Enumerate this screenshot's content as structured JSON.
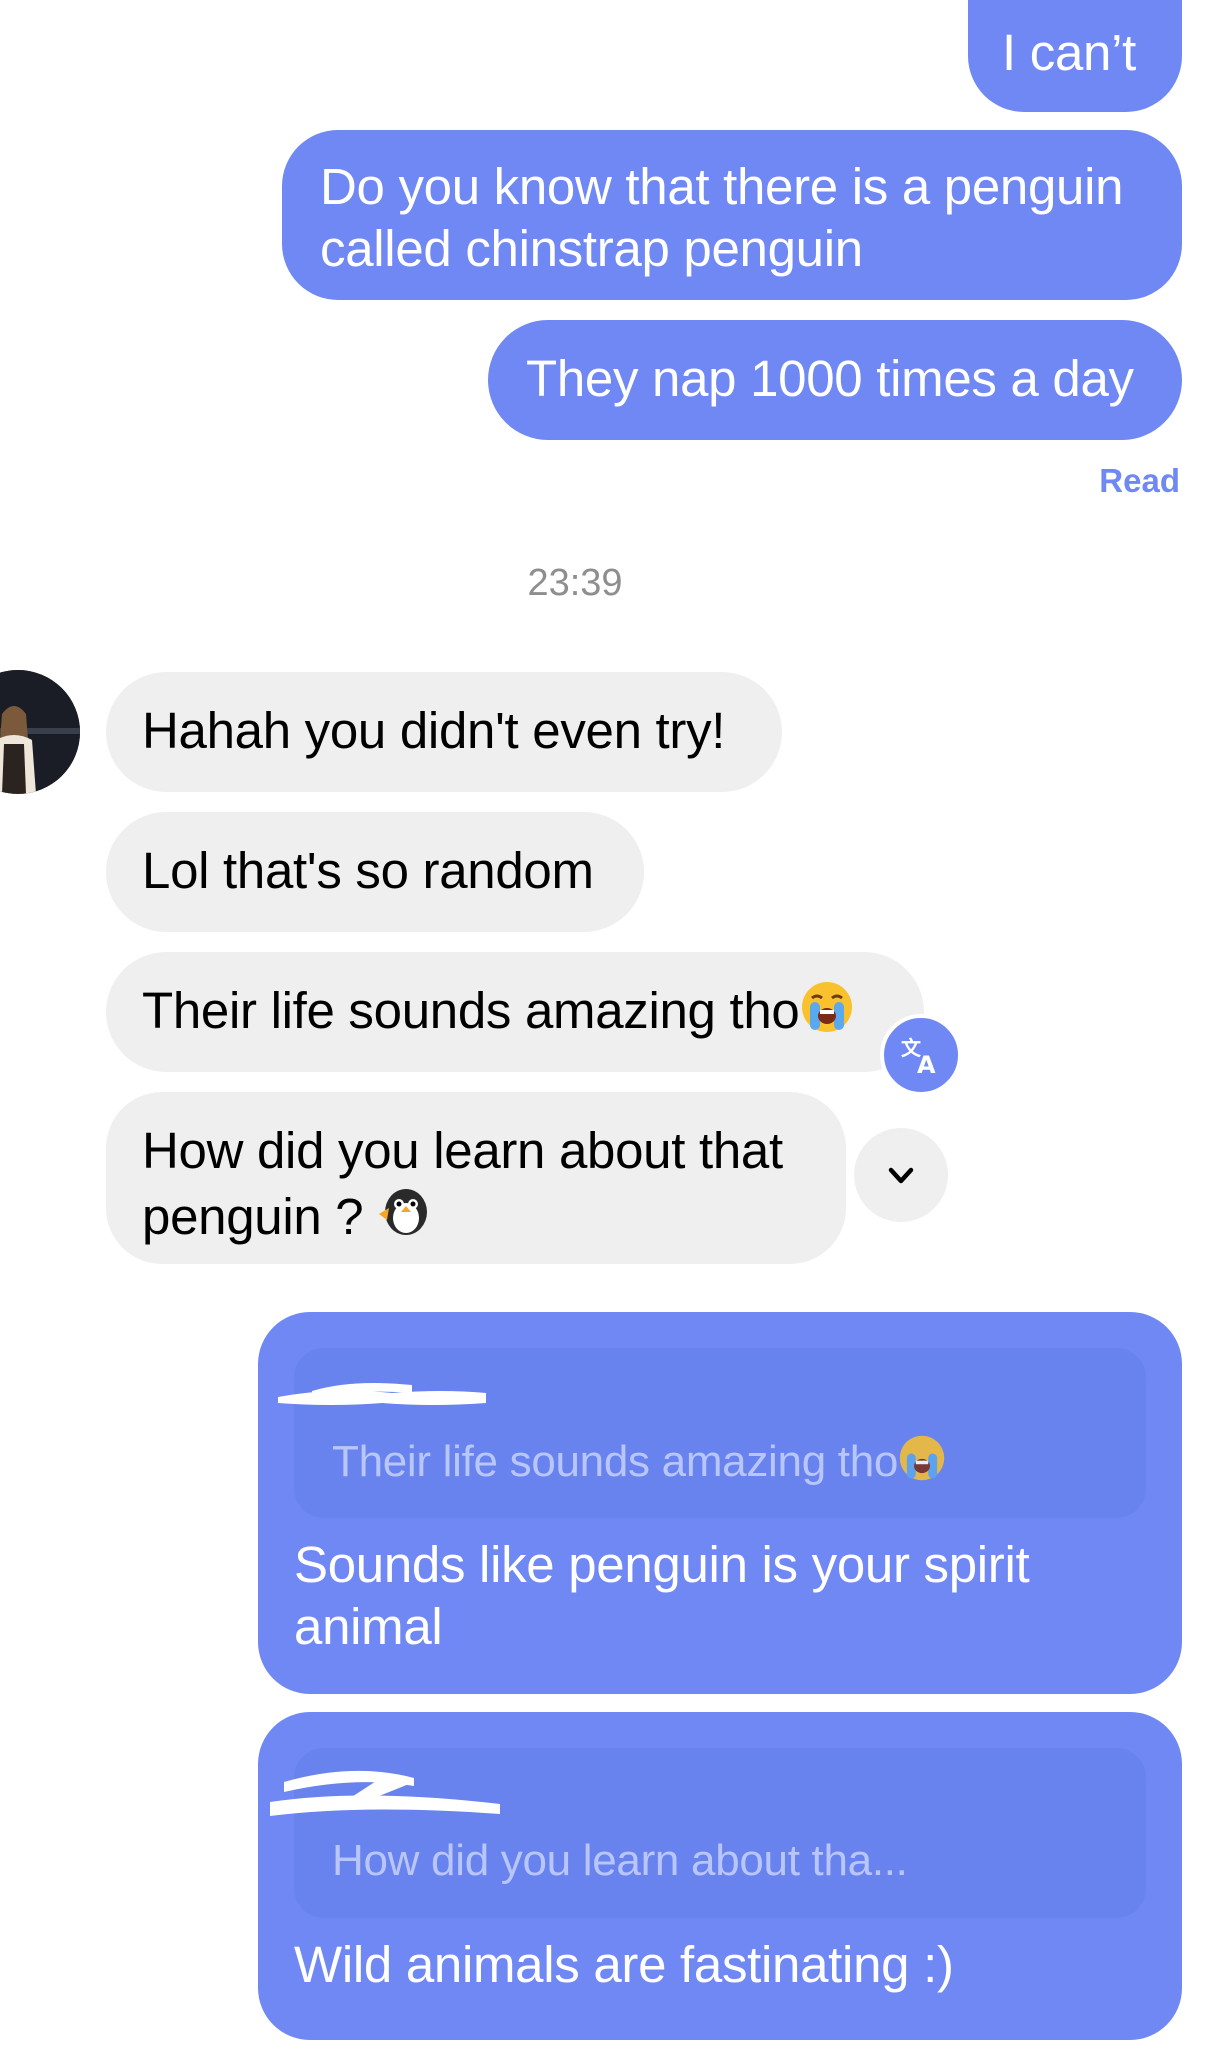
{
  "chat": {
    "colors": {
      "outgoing_bubble": "#6f88f3",
      "incoming_bubble": "#efefef",
      "read_label": "#6f88f3",
      "timestamp": "#8e8e8e"
    },
    "sent_top": [
      {
        "text": "I can’t"
      },
      {
        "text": "Do you know that there is a penguin called chinstrap penguin"
      },
      {
        "text": "They nap 1000 times a day"
      }
    ],
    "read_status": "Read",
    "timestamp": "23:39",
    "received": [
      {
        "text": "Hahah you didn't even try!"
      },
      {
        "text": "Lol that's so random"
      },
      {
        "text": "Their life sounds amazing tho",
        "emoji": "loudly-crying-face-icon"
      },
      {
        "text": "How did you learn about that penguin ?",
        "emoji": "penguin-icon"
      }
    ],
    "replies": [
      {
        "quoted_author": "redacted",
        "quoted_text": "Their life sounds amazing tho",
        "quoted_emoji": "loudly-crying-face-icon",
        "text": "Sounds like penguin is your spirit animal"
      },
      {
        "quoted_author": "redacted",
        "quoted_text": "How did you learn about tha...",
        "text": "Wild animals are fastinating :)"
      }
    ],
    "icons": {
      "translate": "translate-icon",
      "expand": "chevron-down-icon",
      "avatar": "avatar"
    }
  }
}
